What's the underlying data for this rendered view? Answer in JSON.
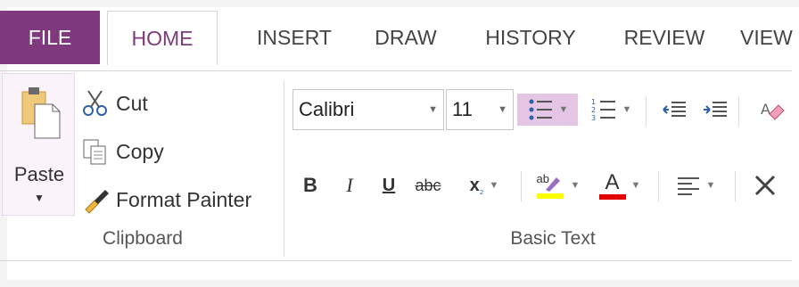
{
  "tabs": [
    {
      "label": "FILE"
    },
    {
      "label": "HOME"
    },
    {
      "label": "INSERT"
    },
    {
      "label": "DRAW"
    },
    {
      "label": "HISTORY"
    },
    {
      "label": "REVIEW"
    },
    {
      "label": "VIEW"
    }
  ],
  "clipboard": {
    "paste_label": "Paste",
    "cut_label": "Cut",
    "copy_label": "Copy",
    "format_painter_label": "Format Painter",
    "group_label": "Clipboard"
  },
  "basic_text": {
    "font_name": "Calibri",
    "font_size": "11",
    "bold": "B",
    "italic": "I",
    "underline": "U",
    "strikethrough": "abc",
    "subscript": "x",
    "subscript_mark": "₂",
    "highlight_letters": "ab",
    "font_color_letter": "A",
    "group_label": "Basic Text",
    "highlight_color": "#ffff00",
    "font_color": "#e00000"
  },
  "colors": {
    "accent": "#7f3a7e",
    "selected": "#e4c5e4"
  }
}
